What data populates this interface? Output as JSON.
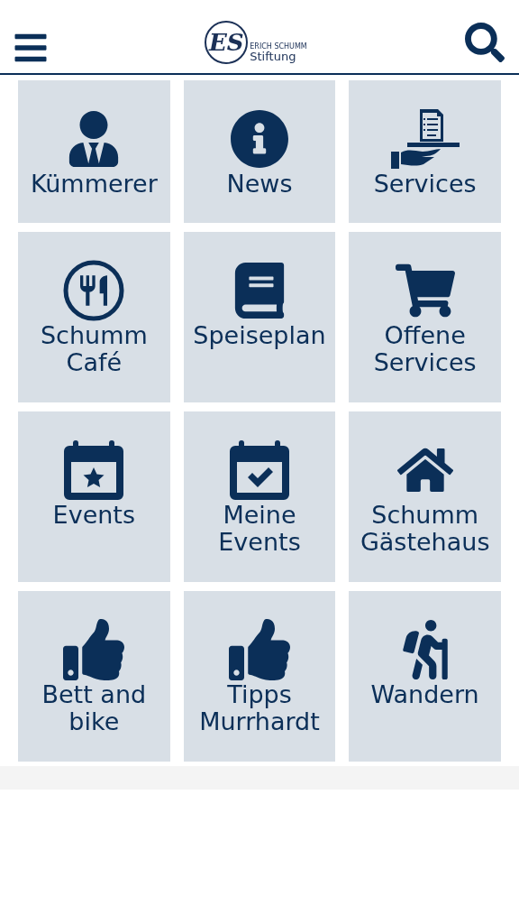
{
  "header": {
    "logo_mark": "ES",
    "logo_small": "ERICH SCHUMM",
    "logo_name": "Stiftung"
  },
  "tiles": [
    {
      "label": "Kümmerer"
    },
    {
      "label": "News"
    },
    {
      "label": "Services"
    },
    {
      "label": "Schumm Café"
    },
    {
      "label": "Speiseplan"
    },
    {
      "label": "Offene Services"
    },
    {
      "label": "Events"
    },
    {
      "label": "Meine Events"
    },
    {
      "label": "Schumm Gästehaus"
    },
    {
      "label": "Bett and bike"
    },
    {
      "label": "Tipps Murrhardt"
    },
    {
      "label": "Wandern"
    }
  ]
}
